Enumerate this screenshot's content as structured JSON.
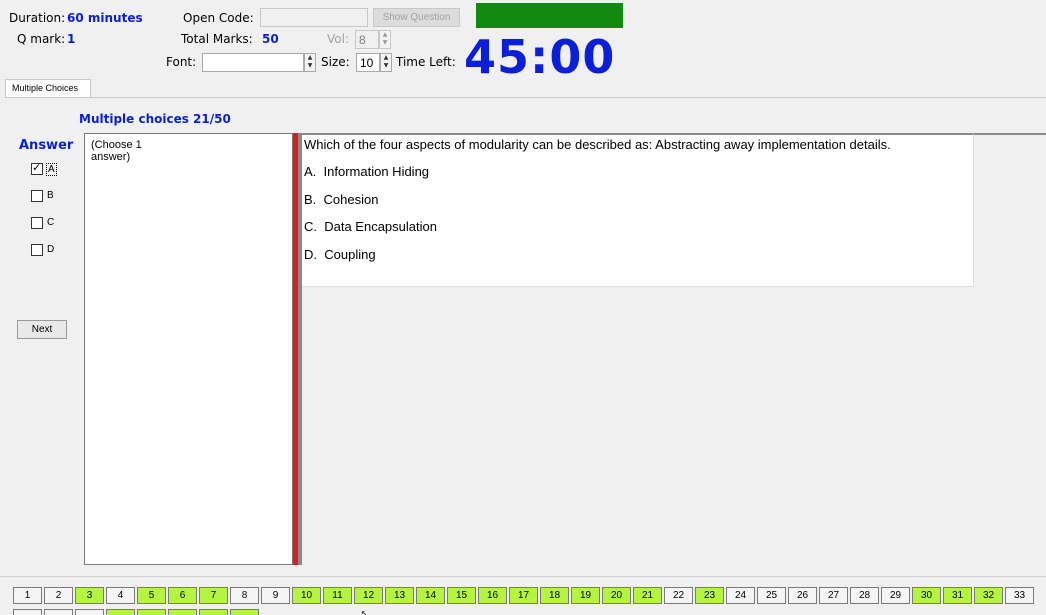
{
  "header": {
    "duration_label": "Duration:",
    "duration_value": "60 minutes",
    "qmark_label": "Q mark:",
    "qmark_value": "1",
    "open_code_label": "Open Code:",
    "open_code_value": "",
    "show_question_label": "Show Question",
    "total_marks_label": "Total Marks:",
    "total_marks_value": "50",
    "vol_label": "Vol:",
    "vol_value": "8",
    "font_label": "Font:",
    "font_value": "",
    "size_label": "Size:",
    "size_value": "10",
    "time_left_label": "Time Left:",
    "time_left_value": "45:00"
  },
  "tab": {
    "label": "Multiple Choices"
  },
  "section_title": "Multiple choices 21/50",
  "answer": {
    "heading": "Answer",
    "options": [
      {
        "label": "A",
        "checked": true
      },
      {
        "label": "B",
        "checked": false
      },
      {
        "label": "C",
        "checked": false
      },
      {
        "label": "D",
        "checked": false
      }
    ],
    "next_label": "Next"
  },
  "instruction": "(Choose 1 answer)",
  "question": {
    "text": "Which of the four aspects of modularity can be described as: Abstracting away implementation details.",
    "options": [
      {
        "letter": "A.",
        "text": "Information Hiding"
      },
      {
        "letter": "B.",
        "text": "Cohesion"
      },
      {
        "letter": "C.",
        "text": "Data Encapsulation"
      },
      {
        "letter": "D.",
        "text": "Coupling"
      }
    ]
  },
  "navigator": {
    "questions": [
      {
        "n": "1",
        "answered": false
      },
      {
        "n": "2",
        "answered": false
      },
      {
        "n": "3",
        "answered": true
      },
      {
        "n": "4",
        "answered": false
      },
      {
        "n": "5",
        "answered": true
      },
      {
        "n": "6",
        "answered": true
      },
      {
        "n": "7",
        "answered": true
      },
      {
        "n": "8",
        "answered": false
      },
      {
        "n": "9",
        "answered": false
      },
      {
        "n": "10",
        "answered": true
      },
      {
        "n": "11",
        "answered": true
      },
      {
        "n": "12",
        "answered": true
      },
      {
        "n": "13",
        "answered": true
      },
      {
        "n": "14",
        "answered": true
      },
      {
        "n": "15",
        "answered": true
      },
      {
        "n": "16",
        "answered": true
      },
      {
        "n": "17",
        "answered": true
      },
      {
        "n": "18",
        "answered": true
      },
      {
        "n": "19",
        "answered": true
      },
      {
        "n": "20",
        "answered": true
      },
      {
        "n": "21",
        "answered": true
      },
      {
        "n": "22",
        "answered": false
      },
      {
        "n": "23",
        "answered": true
      },
      {
        "n": "24",
        "answered": false
      },
      {
        "n": "25",
        "answered": false
      },
      {
        "n": "26",
        "answered": false
      },
      {
        "n": "27",
        "answered": false
      },
      {
        "n": "28",
        "answered": false
      },
      {
        "n": "29",
        "answered": false
      },
      {
        "n": "30",
        "answered": true
      },
      {
        "n": "31",
        "answered": true
      },
      {
        "n": "32",
        "answered": true
      },
      {
        "n": "33",
        "answered": false
      }
    ],
    "answered_color": "#b5f542"
  },
  "colors": {
    "accent": "#0a1fd6",
    "timer_bar": "#108a10",
    "divider": "#e01b1b"
  }
}
